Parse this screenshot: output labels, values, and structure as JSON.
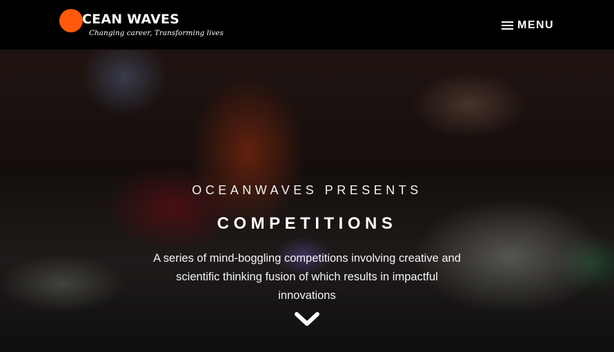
{
  "header": {
    "logo_name": "CEAN WAVES",
    "logo_tagline": "Changing career, Transforming lives",
    "menu_label": "MENU",
    "brand_color": "#ff5a0a"
  },
  "hero": {
    "eyebrow": "OCEANWAVES PRESENTS",
    "title": "COMPETITIONS",
    "description": "A series of mind-boggling competitions involving creative and scientific thinking fusion of which results in impactful innovations",
    "scroll_icon": "chevron-down-icon"
  }
}
